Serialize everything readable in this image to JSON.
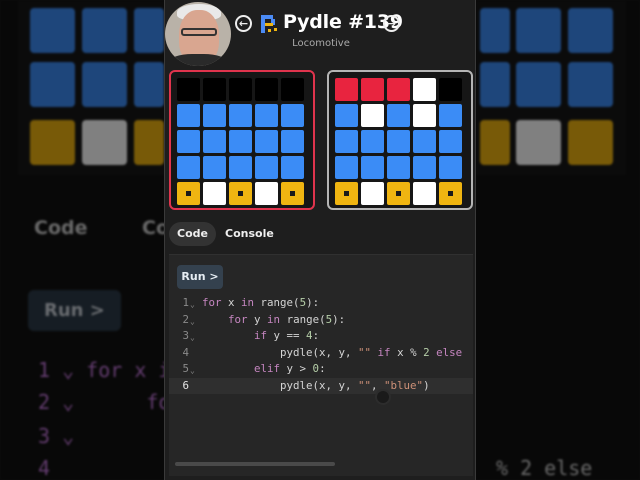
{
  "header": {
    "title": "Pydle #139",
    "subtitle": "Locomotive",
    "prev_icon": "arrow-left-circle-icon",
    "next_icon": "arrow-right-circle-icon",
    "logo_icon": "pydle-logo-icon",
    "prev_glyph": "←",
    "next_glyph": "→"
  },
  "colors": {
    "black": "#000000",
    "blue": "#3b8cf6",
    "white": "#ffffff",
    "yellow": "#f0b511",
    "red": "#e8243f",
    "output_border": "#e0344d",
    "target_border": "#b5b5b5"
  },
  "output_grid": [
    [
      "black",
      "black",
      "black",
      "black",
      "black"
    ],
    [
      "blue",
      "blue",
      "blue",
      "blue",
      "blue"
    ],
    [
      "blue",
      "blue",
      "blue",
      "blue",
      "blue"
    ],
    [
      "blue",
      "blue",
      "blue",
      "blue",
      "blue"
    ],
    [
      "yellow",
      "white",
      "yellow",
      "white",
      "yellow"
    ]
  ],
  "target_grid": [
    [
      "red",
      "red",
      "red",
      "white",
      "black"
    ],
    [
      "blue",
      "white",
      "blue",
      "white",
      "blue"
    ],
    [
      "blue",
      "blue",
      "blue",
      "blue",
      "blue"
    ],
    [
      "blue",
      "blue",
      "blue",
      "blue",
      "blue"
    ],
    [
      "yellow",
      "white",
      "yellow",
      "white",
      "yellow"
    ]
  ],
  "tabs": [
    {
      "label": "Code",
      "active": true
    },
    {
      "label": "Console",
      "active": false
    }
  ],
  "editor": {
    "run_label": "Run >",
    "current_line": 6,
    "lines": [
      {
        "num": "1",
        "fold": true,
        "code": "for x in range(5):"
      },
      {
        "num": "2",
        "fold": true,
        "code": "    for y in range(5):"
      },
      {
        "num": "3",
        "fold": true,
        "code": "        if y == 4:"
      },
      {
        "num": "4",
        "fold": false,
        "code": "            pydle(x, y, \"\" if x % 2 else \""
      },
      {
        "num": "5",
        "fold": true,
        "code": "        elif y > 0:"
      },
      {
        "num": "6",
        "fold": false,
        "code": "            pydle(x, y, \"\", \"blue\")"
      }
    ]
  },
  "background": {
    "tab_code": "Code",
    "tab_console": "Co",
    "run_label": "Run >",
    "code_line_1": "1 ⌄ for x i",
    "code_line_2": "2 ⌄      for",
    "code_line_3": "3 ⌄",
    "code_line_4": "4",
    "code_tail": "% 2 else"
  }
}
